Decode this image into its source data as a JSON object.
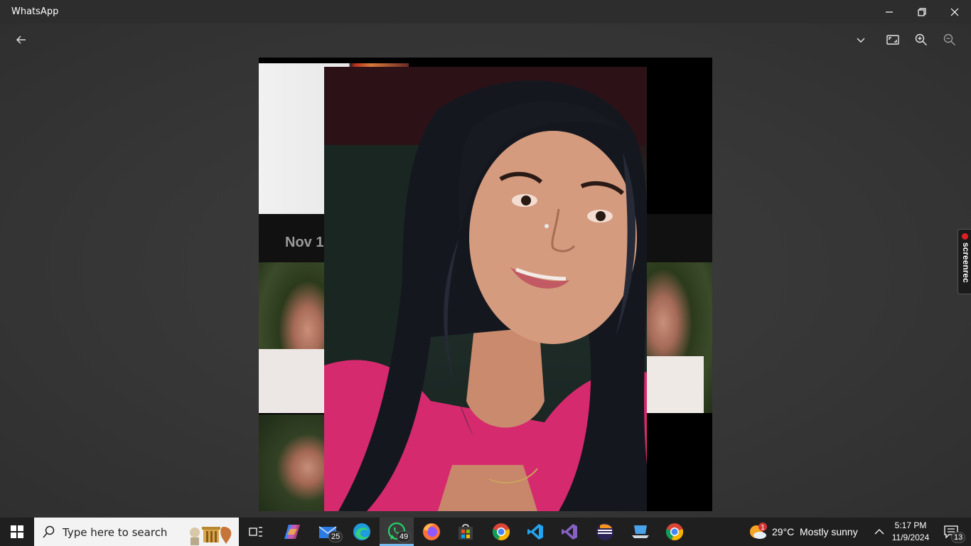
{
  "window": {
    "title": "WhatsApp"
  },
  "viewer": {
    "date_label": "Nov 1"
  },
  "screenrec": {
    "label": "screenrec"
  },
  "taskbar": {
    "search_placeholder": "Type here to search",
    "mail_badge": "25",
    "whatsapp_badge": "49",
    "weather_temp": "29°C",
    "weather_text": "Mostly sunny",
    "weather_alert": "1",
    "clock_time": "5:17 PM",
    "clock_date": "11/9/2024",
    "notification_count": "13"
  },
  "colors": {
    "accent": "#76b9ed",
    "titlebar": "#2d2d2d",
    "taskbar": "#1f1f1f"
  }
}
